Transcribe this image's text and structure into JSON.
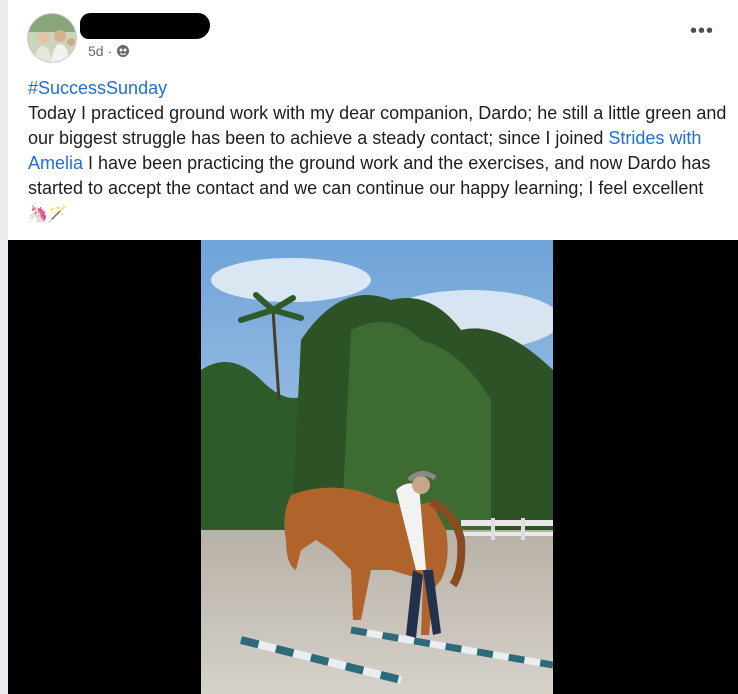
{
  "post": {
    "timestamp": "5d",
    "separator": "·",
    "privacy_icon": "globe-icon",
    "more_icon": "more-options-icon",
    "more_label": "•••",
    "hashtag": "#SuccessSunday",
    "body_part1": "Today I practiced ground work with my dear companion, Dardo; he still a little green and our biggest struggle has been to achieve a steady contact; since I joined ",
    "link_text": "Strides with Amelia",
    "body_part2": " I have been practicing the ground work and the exercises, and now Dardo has started to accept the contact and we can continue our happy learning; I feel excellent ",
    "emojis": "🦄🪄"
  },
  "colors": {
    "link": "#216fdb",
    "text": "#1c1e21",
    "meta": "#65676b",
    "video_bg": "#000000"
  }
}
